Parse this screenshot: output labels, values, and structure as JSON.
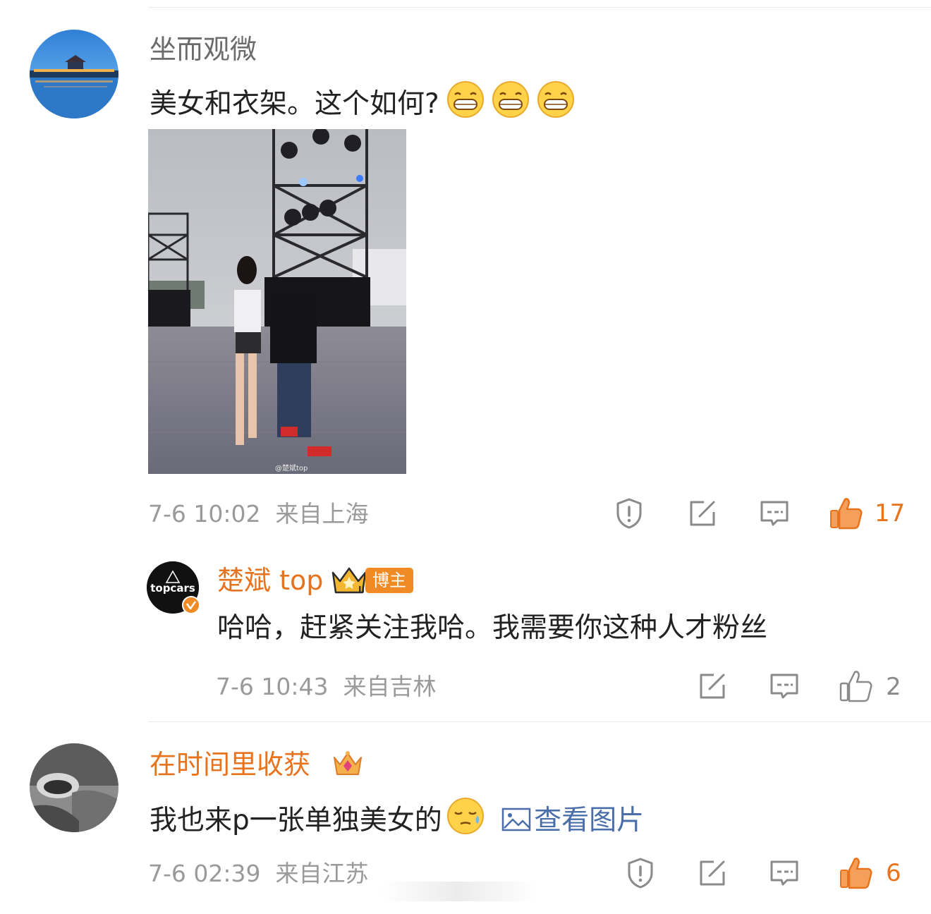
{
  "colors": {
    "accent_orange": "#e8731e",
    "link_blue": "#4a6ea9",
    "meta_gray": "#9a9a9a",
    "text": "#222222"
  },
  "comments": [
    {
      "username": "坐而观微",
      "text": "美女和衣架。这个如何?",
      "emojis": [
        "grin-emoji",
        "grin-emoji",
        "grin-emoji"
      ],
      "image_watermark": "@楚斌top",
      "time": "7-6 10:02",
      "location": "来自上海",
      "like_count": "17",
      "liked": true
    },
    {
      "username": "楚斌 top",
      "avatar_text": "topcars",
      "badge": "博主",
      "text": "哈哈，赶紧关注我哈。我需要你这种人才粉丝",
      "time": "7-6 10:43",
      "location": "来自吉林",
      "like_count": "2",
      "liked": false
    },
    {
      "username": "在时间里收获",
      "text": "我也来p一张单独美女的",
      "emoji": "sweat-emoji",
      "link_label": "查看图片",
      "time": "7-6 02:39",
      "location": "来自江苏",
      "like_count": "6",
      "liked": true
    }
  ]
}
